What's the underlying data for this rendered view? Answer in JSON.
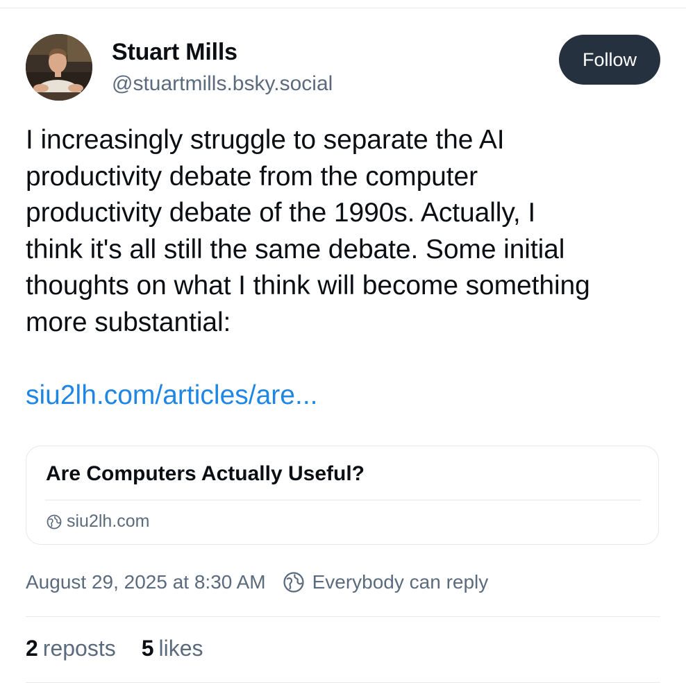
{
  "author": {
    "display_name": "Stuart Mills",
    "handle": "@stuartmills.bsky.social",
    "avatar_icon": "avatar-photo"
  },
  "follow_button": {
    "label": "Follow",
    "background": "#25313f"
  },
  "post": {
    "text": "I increasingly struggle to separate the AI\nproductivity debate from the computer\nproductivity debate of the 1990s. Actually, I\nthink it's all still the same debate. Some initial\nthoughts on what I think will become something\nmore substantial:",
    "link": "siu2lh.com/articles/are..."
  },
  "link_card": {
    "title": "Are Computers Actually Useful?",
    "domain": "siu2lh.com",
    "domain_icon": "globe-icon"
  },
  "meta": {
    "timestamp": "August 29, 2025 at 8:30 AM",
    "reply_setting": "Everybody can reply",
    "reply_icon": "globe-icon"
  },
  "stats": {
    "reposts_count": "2",
    "reposts_label": "reposts",
    "likes_count": "5",
    "likes_label": "likes"
  },
  "colors": {
    "text": "#0b0f14",
    "muted": "#5b6b7d",
    "link": "#1e86e5",
    "border": "#e3e7ec"
  }
}
